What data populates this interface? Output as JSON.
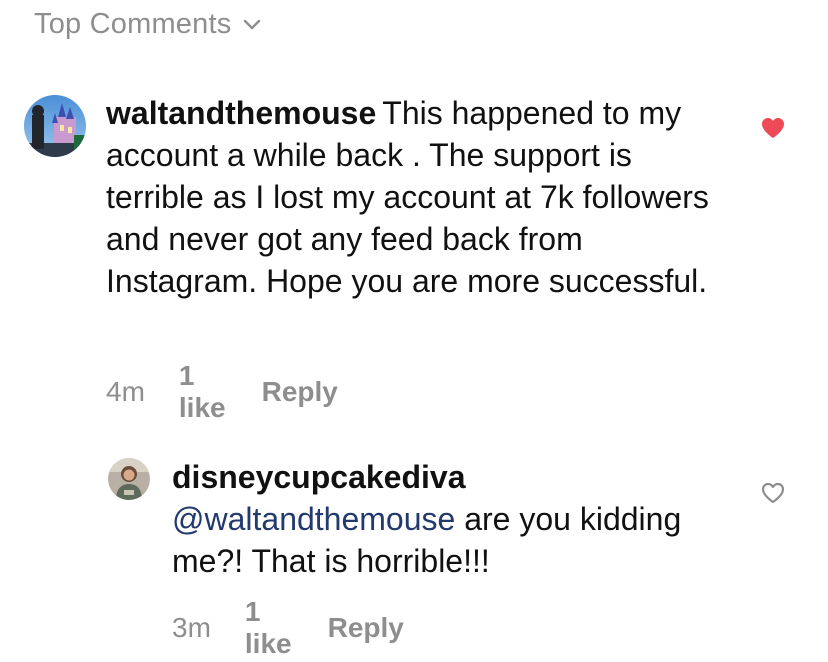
{
  "header": {
    "label": "Top Comments",
    "dropdown_icon": "chevron-down-icon"
  },
  "comments": [
    {
      "username": "waltandthemouse",
      "text": "This happened to my account a while back . The support is terrible as I lost my account at 7k followers and never got any feed back from Instagram. Hope you are more successful.",
      "time": "4m",
      "likes": "1 like",
      "reply": "Reply",
      "liked": true,
      "heart_icon": "heart-filled-icon"
    },
    {
      "username": "disneycupcakediva",
      "mention": "@waltandthemouse",
      "text": "are you kidding me?! That is horrible!!!",
      "time": "3m",
      "likes": "1 like",
      "reply": "Reply",
      "liked": false,
      "heart_icon": "heart-outline-icon"
    }
  ],
  "colors": {
    "muted": "#8e8e8e",
    "mention": "#233a6e",
    "liked_heart": "#ed4956"
  }
}
